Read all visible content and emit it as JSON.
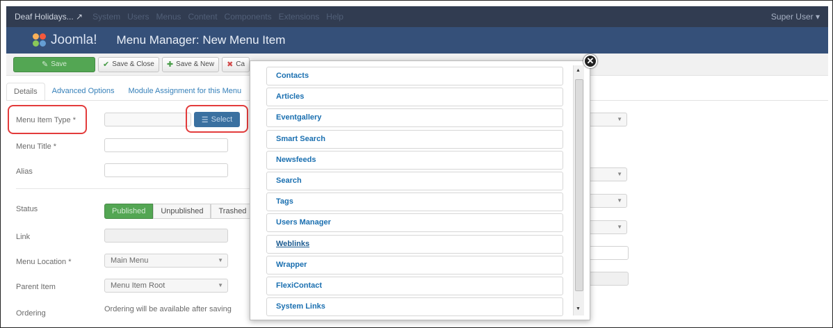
{
  "topnav": {
    "site": "Deaf Holidays...",
    "items": [
      "System",
      "Users",
      "Menus",
      "Content",
      "Components",
      "Extensions",
      "Help"
    ],
    "user": "Super User"
  },
  "header": {
    "logo": "Joomla!",
    "title": "Menu Manager: New Menu Item"
  },
  "toolbar": {
    "save": "Save",
    "save_close": "Save & Close",
    "save_new": "Save & New",
    "cancel": "Ca"
  },
  "tabs": [
    "Details",
    "Advanced Options",
    "Module Assignment for this Menu"
  ],
  "form": {
    "menu_item_type_label": "Menu Item Type *",
    "select_button": "Select",
    "menu_title_label": "Menu Title *",
    "alias_label": "Alias",
    "status_label": "Status",
    "status_options": [
      "Published",
      "Unpublished",
      "Trashed"
    ],
    "link_label": "Link",
    "menu_location_label": "Menu Location *",
    "menu_location_value": "Main Menu",
    "parent_item_label": "Parent Item",
    "parent_item_value": "Menu Item Root",
    "ordering_label": "Ordering",
    "ordering_note": "Ordering will be available after saving"
  },
  "modal": {
    "items": [
      "Contacts",
      "Articles",
      "Eventgallery",
      "Smart Search",
      "Newsfeeds",
      "Search",
      "Tags",
      "Users Manager",
      "Weblinks",
      "Wrapper",
      "FlexiContact",
      "System Links"
    ]
  }
}
